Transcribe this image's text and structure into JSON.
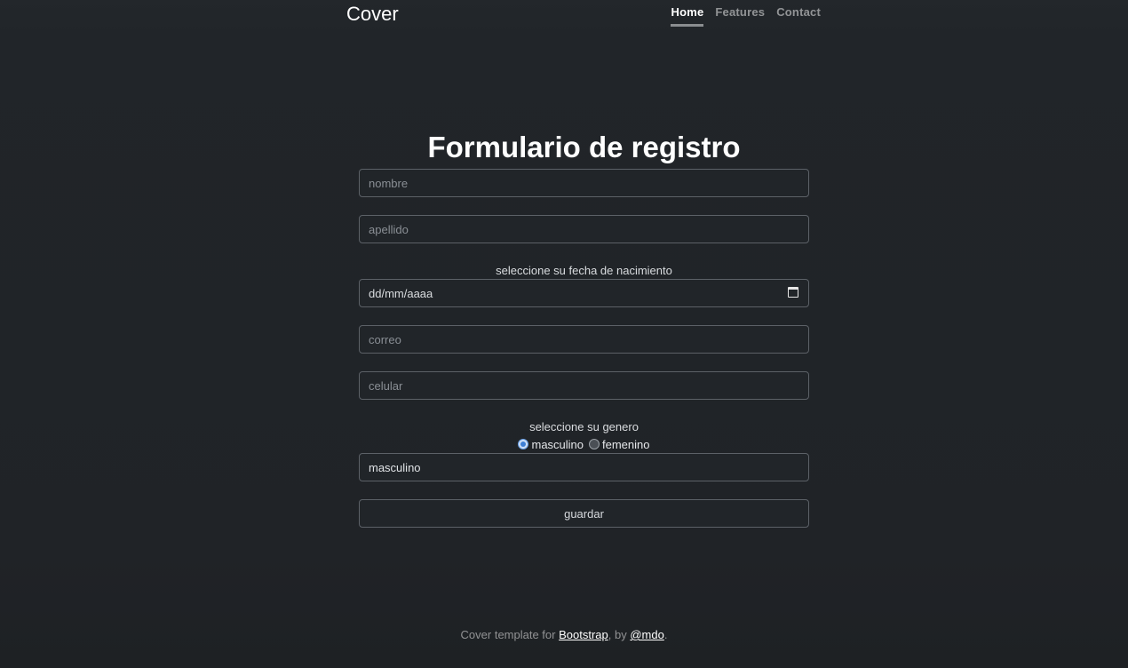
{
  "header": {
    "brand": "Cover",
    "nav": [
      {
        "label": "Home",
        "active": true
      },
      {
        "label": "Features",
        "active": false
      },
      {
        "label": "Contact",
        "active": false
      }
    ]
  },
  "form": {
    "title": "Formulario de registro",
    "nombre": {
      "placeholder": "nombre",
      "value": ""
    },
    "apellido": {
      "placeholder": "apellido",
      "value": ""
    },
    "fecha_label": "seleccione su fecha de nacimiento",
    "fecha": {
      "placeholder": "dd/mm/aaaa"
    },
    "correo": {
      "placeholder": "correo",
      "value": ""
    },
    "celular": {
      "placeholder": "celular",
      "value": ""
    },
    "genero_label": "seleccione su genero",
    "genero_options": [
      {
        "label": "masculino",
        "checked": true
      },
      {
        "label": "femenino",
        "checked": false
      }
    ],
    "genero_value": "masculino",
    "submit_label": "guardar"
  },
  "footer": {
    "prefix": "Cover template for ",
    "link1": "Bootstrap",
    "middle": ", by ",
    "link2": "@mdo",
    "suffix": "."
  },
  "colors": {
    "background": "#212529",
    "text": "#ffffff",
    "radio_accent": "#3d7fd6"
  },
  "icons": [
    "calendar-icon"
  ]
}
